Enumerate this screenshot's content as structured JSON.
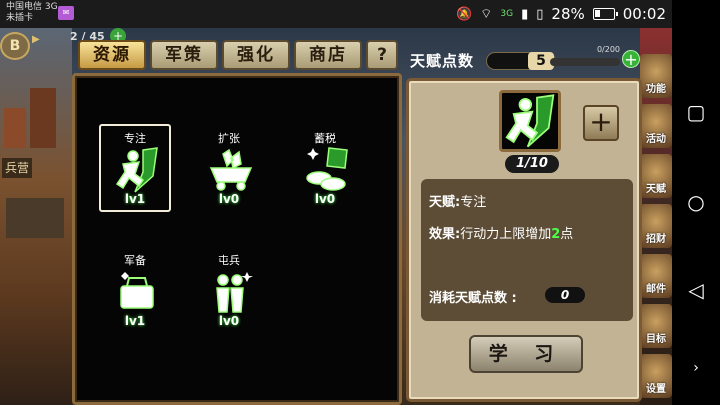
{
  "status_bar": {
    "carrier_line1": "中国电信 3G",
    "carrier_line2": "未插卡",
    "network_type": "3G",
    "battery_percent": "28%",
    "battery_level": 0.28,
    "time": "00:02"
  },
  "game": {
    "side_label": "兵营",
    "resource_counter": "2 / 45",
    "tabs": [
      {
        "label": "资源",
        "active": true
      },
      {
        "label": "军策",
        "active": false
      },
      {
        "label": "强化",
        "active": false
      },
      {
        "label": "商店",
        "active": false
      },
      {
        "label": "?",
        "active": false
      }
    ],
    "talents": [
      {
        "label": "专注",
        "level": "lv1",
        "selected": true
      },
      {
        "label": "扩张",
        "level": "lv0",
        "selected": false
      },
      {
        "label": "蓄税",
        "level": "lv0",
        "selected": false
      },
      {
        "label": "军备",
        "level": "lv1",
        "selected": false
      },
      {
        "label": "屯兵",
        "level": "lv0",
        "selected": false
      }
    ],
    "talent_points": {
      "label": "天赋点数",
      "value": "5",
      "exp_text": "0/200"
    },
    "detail": {
      "level_count": "1/10",
      "talent_label": "天赋:",
      "talent_name": "专注",
      "effect_label": "效果:",
      "effect_pre": "行动力上限增加",
      "effect_value": "2",
      "effect_post": "点",
      "cost_label": "消耗天赋点数 :",
      "cost_value": "0",
      "learn_button": "学 习"
    },
    "right_icons": [
      "功能",
      "活动",
      "天赋",
      "招财",
      "邮件",
      "目标",
      "设置"
    ]
  },
  "colors": {
    "accent_green": "#4cff4c",
    "panel_frame": "#8b6b3e",
    "active_tab": "#f8e39a"
  }
}
